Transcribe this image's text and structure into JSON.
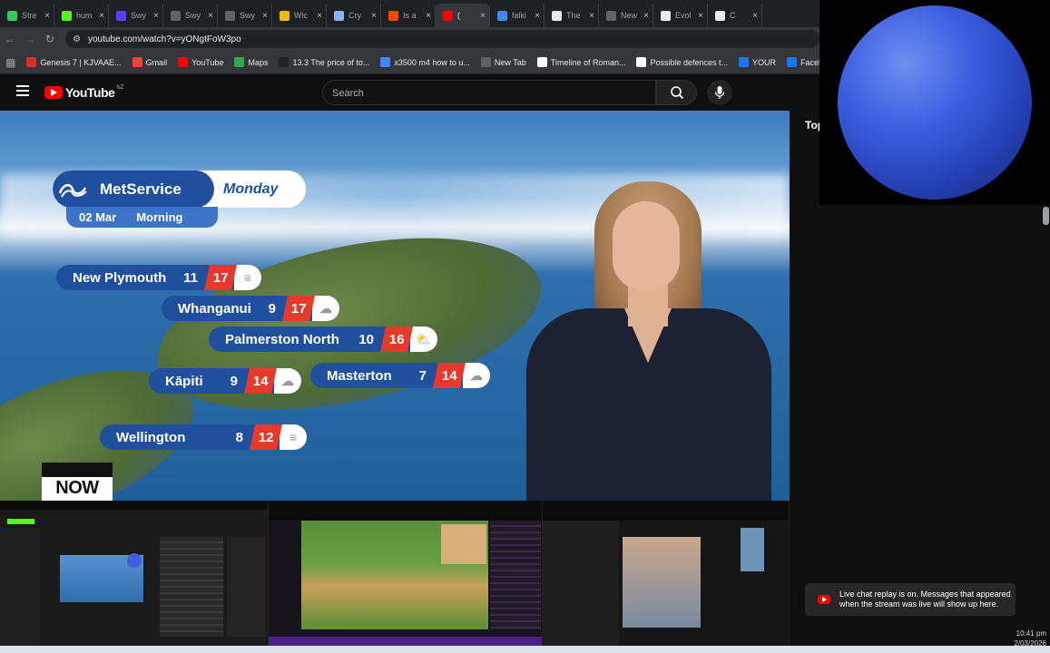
{
  "tabs": [
    {
      "title": "Stre",
      "color": "#34c759",
      "active": false
    },
    {
      "title": "hum",
      "color": "#53fc18",
      "active": false
    },
    {
      "title": "Swy",
      "color": "#5b3df5",
      "active": false
    },
    {
      "title": "Swy",
      "color": "#5f6368",
      "active": false
    },
    {
      "title": "Swy",
      "color": "#5f6368",
      "active": false
    },
    {
      "title": "Wic",
      "color": "#f0b90b",
      "active": false
    },
    {
      "title": "Cry",
      "color": "#8ab4f8",
      "active": false
    },
    {
      "title": "Is a",
      "color": "#ff4500",
      "active": false
    },
    {
      "title": "(",
      "color": "#ff0000",
      "active": true
    },
    {
      "title": "falki",
      "color": "#4285f4",
      "active": false
    },
    {
      "title": "The",
      "color": "#e8eaed",
      "active": false
    },
    {
      "title": "New",
      "color": "#5f6368",
      "active": false
    },
    {
      "title": "Evol",
      "color": "#e8eaed",
      "active": false
    },
    {
      "title": "C",
      "color": "#e8eaed",
      "active": false
    }
  ],
  "address": {
    "url": "youtube.com/watch?v=yONgtFoW3po"
  },
  "bookmarks": [
    {
      "label": "Genesis 7 | KJVAAE...",
      "color": "#d93025"
    },
    {
      "label": "Gmail",
      "color": "#ea4335"
    },
    {
      "label": "YouTube",
      "color": "#ff0000"
    },
    {
      "label": "Maps",
      "color": "#34a853"
    },
    {
      "label": "13.3 The price of to...",
      "color": "#202124"
    },
    {
      "label": "x3500 m4 how to u...",
      "color": "#4285f4"
    },
    {
      "label": "New Tab",
      "color": "#5f6368"
    },
    {
      "label": "Timeline of Roman...",
      "color": "#ffffff"
    },
    {
      "label": "Possible defences t...",
      "color": "#ffffff"
    },
    {
      "label": "YOUR",
      "color": "#1877f2"
    },
    {
      "label": "Facebook green",
      "color": "#1877f2"
    }
  ],
  "youtube": {
    "logo": "YouTube",
    "region": "NZ",
    "search_placeholder": "Search",
    "side_tab": "Top"
  },
  "video": {
    "brand": "MetService",
    "day": "Monday",
    "date": "02 Mar",
    "period": "Morning",
    "cities": [
      {
        "name": "New Plymouth",
        "min": "11",
        "max": "17",
        "icon": "wind-icon"
      },
      {
        "name": "Whanganui",
        "min": "9",
        "max": "17",
        "icon": "cloud-icon"
      },
      {
        "name": "Palmerston North",
        "min": "10",
        "max": "16",
        "icon": "partly-sunny-icon"
      },
      {
        "name": "Kāpiti",
        "min": "9",
        "max": "14",
        "icon": "cloud-icon"
      },
      {
        "name": "Masterton",
        "min": "7",
        "max": "14",
        "icon": "cloud-icon"
      },
      {
        "name": "Wellington",
        "min": "8",
        "max": "12",
        "icon": "wind-icon"
      }
    ],
    "now_badge": "NOW"
  },
  "chat": {
    "replay_notice": "Live chat replay is on. Messages that appeared when the stream was live will show up here."
  },
  "system": {
    "time": "10:41 pm",
    "date": "2/03/2026"
  }
}
